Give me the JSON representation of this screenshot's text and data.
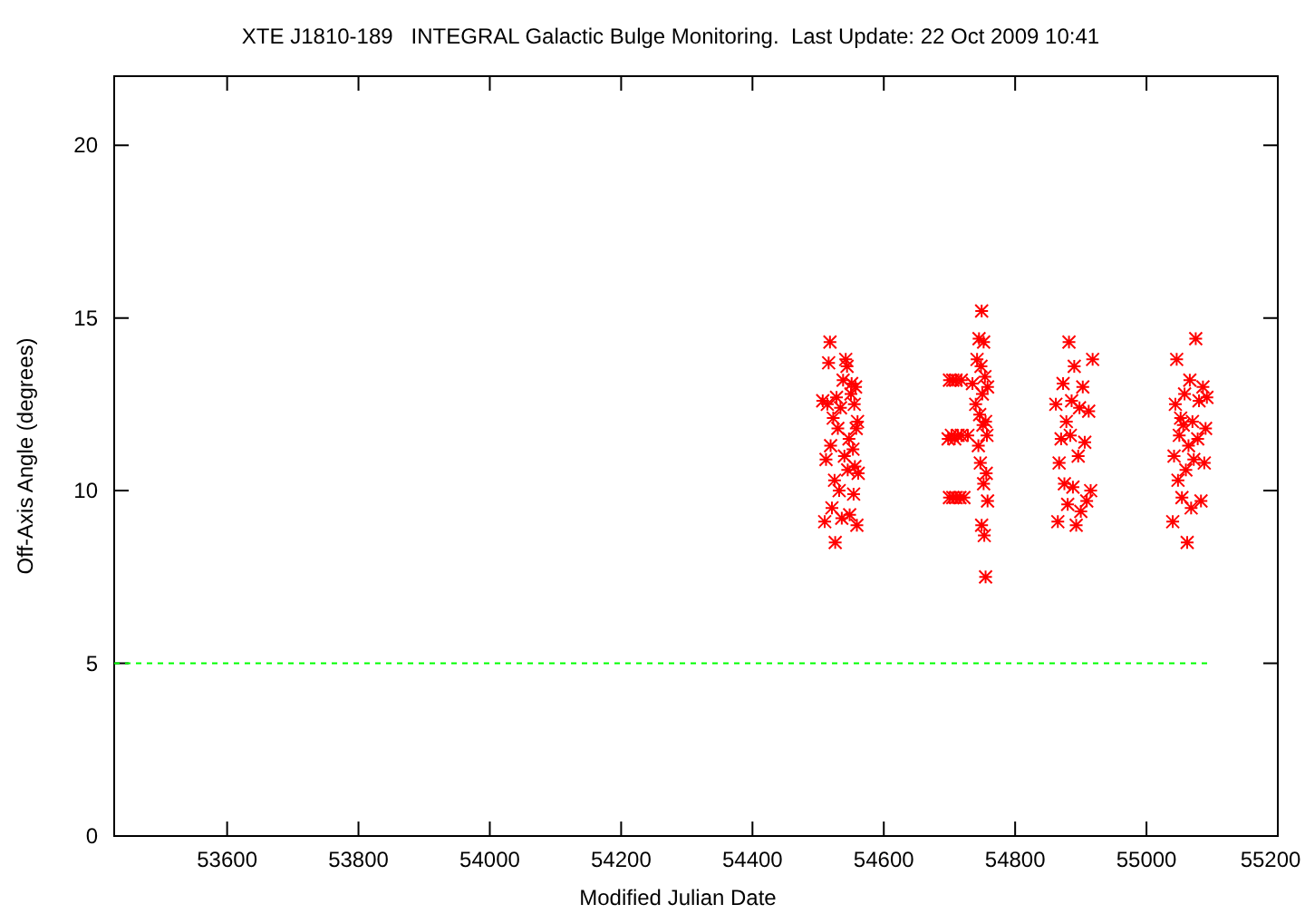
{
  "chart_data": {
    "type": "scatter",
    "title": "XTE J1810-189   INTEGRAL Galactic Bulge Monitoring.  Last Update: 22 Oct 2009 10:41",
    "xlabel": "Modified Julian Date",
    "ylabel": "Off-Axis Angle (degrees)",
    "xlim": [
      53428,
      55200
    ],
    "ylim": [
      0,
      22
    ],
    "xticks": [
      53600,
      53800,
      54000,
      54200,
      54400,
      54600,
      54800,
      55000,
      55200
    ],
    "yticks": [
      0,
      5,
      10,
      15,
      20
    ],
    "series": [
      {
        "color": "#ff0000",
        "x": [
          54507,
          54510,
          54512,
          54514,
          54516,
          54518,
          54519,
          54521,
          54523,
          54525,
          54526,
          54528,
          54530,
          54532,
          54534,
          54536,
          54538,
          54540,
          54542,
          54544,
          54545,
          54547,
          54548,
          54550,
          54551,
          54553,
          54554,
          54555,
          54556,
          54557,
          54558,
          54559,
          54560,
          54561,
          54700,
          54705,
          54710,
          54718,
          54698,
          54703,
          54708,
          54713,
          54718,
          54700,
          54705,
          54710,
          54716,
          54722,
          54728,
          54735,
          54740,
          54742,
          54744,
          54745,
          54746,
          54747,
          54748,
          54749,
          54749,
          54750,
          54751,
          54752,
          54752,
          54753,
          54754,
          54755,
          54755,
          54756,
          54757,
          54758,
          54758,
          54862,
          54865,
          54867,
          54870,
          54873,
          54875,
          54878,
          54880,
          54882,
          54884,
          54886,
          54888,
          54890,
          54893,
          54896,
          54898,
          54900,
          54903,
          54906,
          54909,
          54912,
          54915,
          54918,
          55040,
          55042,
          55044,
          55046,
          55048,
          55050,
          55052,
          55054,
          55056,
          55058,
          55060,
          55062,
          55064,
          55066,
          55068,
          55070,
          55072,
          55075,
          55078,
          55080,
          55083,
          55086,
          55088,
          55090,
          55092
        ],
        "values": [
          12.6,
          9.1,
          10.9,
          12.5,
          13.7,
          14.3,
          11.3,
          9.5,
          12.1,
          10.3,
          8.5,
          12.7,
          11.8,
          10.0,
          12.4,
          9.2,
          13.2,
          11.0,
          13.8,
          13.6,
          10.6,
          11.5,
          9.3,
          12.8,
          13.1,
          11.2,
          9.9,
          12.5,
          10.7,
          13.0,
          11.8,
          9.0,
          12.0,
          10.5,
          13.2,
          13.2,
          13.2,
          13.2,
          11.5,
          11.6,
          11.5,
          11.6,
          11.6,
          9.8,
          9.8,
          9.8,
          9.8,
          9.8,
          11.6,
          13.1,
          12.5,
          13.8,
          11.3,
          14.4,
          12.2,
          10.8,
          13.6,
          9.0,
          15.2,
          12.8,
          11.9,
          10.2,
          14.3,
          8.7,
          13.3,
          12.0,
          7.5,
          10.5,
          11.6,
          9.7,
          13.0,
          12.5,
          9.1,
          10.8,
          11.5,
          13.1,
          10.2,
          12.0,
          9.6,
          14.3,
          11.6,
          12.6,
          10.1,
          13.6,
          9.0,
          11.0,
          12.4,
          9.4,
          13.0,
          11.4,
          9.7,
          12.3,
          10.0,
          13.8,
          9.1,
          11.0,
          12.5,
          13.8,
          10.3,
          11.6,
          12.1,
          9.8,
          11.9,
          12.8,
          10.6,
          8.5,
          11.3,
          13.2,
          9.5,
          12.0,
          10.9,
          14.4,
          11.5,
          12.6,
          9.7,
          13.0,
          10.8,
          11.8,
          12.7
        ]
      },
      {
        "type": "line",
        "line_style": "dashed",
        "color": "#00ff00",
        "x": [
          53428,
          55100
        ],
        "values": [
          5,
          5
        ]
      }
    ]
  }
}
